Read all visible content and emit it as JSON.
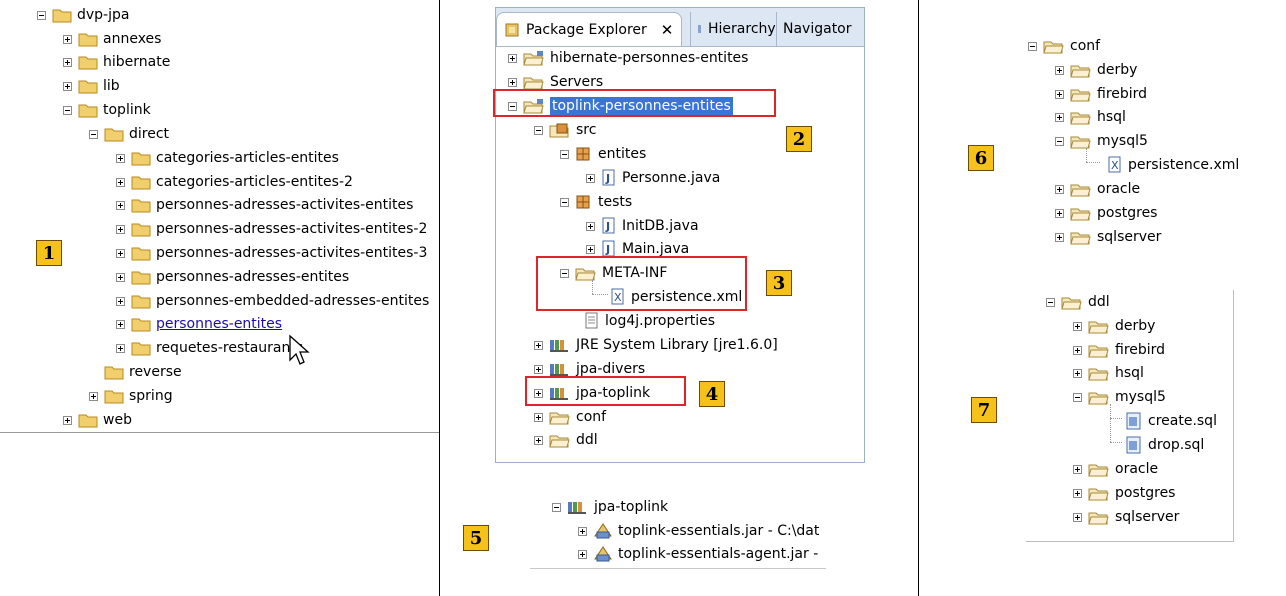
{
  "panel1": {
    "badge": "1",
    "tree": [
      {
        "label": "dvp-jpa",
        "exp": "minus"
      },
      {
        "label": "annexes",
        "exp": "plus"
      },
      {
        "label": "hibernate",
        "exp": "plus"
      },
      {
        "label": "lib",
        "exp": "plus"
      },
      {
        "label": "toplink",
        "exp": "minus"
      },
      {
        "label": "direct",
        "exp": "minus"
      },
      {
        "label": "categories-articles-entites",
        "exp": "plus"
      },
      {
        "label": "categories-articles-entites-2",
        "exp": "plus"
      },
      {
        "label": "personnes-adresses-activites-entites",
        "exp": "plus"
      },
      {
        "label": "personnes-adresses-activites-entites-2",
        "exp": "plus"
      },
      {
        "label": "personnes-adresses-activites-entites-3",
        "exp": "plus"
      },
      {
        "label": "personnes-adresses-entites",
        "exp": "plus"
      },
      {
        "label": "personnes-embedded-adresses-entites",
        "exp": "plus"
      },
      {
        "label": "personnes-entites",
        "exp": "plus"
      },
      {
        "label": "requetes-restaurants",
        "exp": "plus"
      },
      {
        "label": "reverse",
        "exp": "none"
      },
      {
        "label": "spring",
        "exp": "plus"
      },
      {
        "label": "web",
        "exp": "plus"
      }
    ]
  },
  "eclipse": {
    "tabs": {
      "active": "Package Explorer",
      "close": "✕",
      "hierarchy": "Hierarchy",
      "navigator": "Navigator"
    },
    "tree": [
      {
        "label": "hibernate-personnes-entites",
        "exp": "plus"
      },
      {
        "label": "Servers",
        "exp": "plus"
      },
      {
        "label": "toplink-personnes-entites",
        "exp": "minus"
      },
      {
        "label": "src",
        "exp": "minus"
      },
      {
        "label": "entites",
        "exp": "minus"
      },
      {
        "label": "Personne.java",
        "exp": "plus"
      },
      {
        "label": "tests",
        "exp": "minus"
      },
      {
        "label": "InitDB.java",
        "exp": "plus"
      },
      {
        "label": "Main.java",
        "exp": "plus"
      },
      {
        "label": "META-INF",
        "exp": "minus"
      },
      {
        "label": "persistence.xml",
        "exp": "none"
      },
      {
        "label": "log4j.properties",
        "exp": "none"
      },
      {
        "label": "JRE System Library [jre1.6.0]",
        "exp": "plus"
      },
      {
        "label": "jpa-divers",
        "exp": "plus"
      },
      {
        "label": "jpa-toplink",
        "exp": "plus"
      },
      {
        "label": "conf",
        "exp": "plus"
      },
      {
        "label": "ddl",
        "exp": "plus"
      }
    ],
    "badges": [
      "2",
      "3",
      "4"
    ]
  },
  "panel5": {
    "badge": "5",
    "tree": [
      {
        "label": "jpa-toplink",
        "exp": "minus"
      },
      {
        "label": "toplink-essentials.jar - C:\\dat",
        "exp": "plus"
      },
      {
        "label": "toplink-essentials-agent.jar -",
        "exp": "plus"
      }
    ]
  },
  "panel6": {
    "badge": "6",
    "tree": [
      {
        "label": "conf",
        "exp": "minus"
      },
      {
        "label": "derby",
        "exp": "plus"
      },
      {
        "label": "firebird",
        "exp": "plus"
      },
      {
        "label": "hsql",
        "exp": "plus"
      },
      {
        "label": "mysql5",
        "exp": "minus"
      },
      {
        "label": "persistence.xml",
        "exp": "none"
      },
      {
        "label": "oracle",
        "exp": "plus"
      },
      {
        "label": "postgres",
        "exp": "plus"
      },
      {
        "label": "sqlserver",
        "exp": "plus"
      }
    ]
  },
  "panel7": {
    "badge": "7",
    "tree": [
      {
        "label": "ddl",
        "exp": "minus"
      },
      {
        "label": "derby",
        "exp": "plus"
      },
      {
        "label": "firebird",
        "exp": "plus"
      },
      {
        "label": "hsql",
        "exp": "plus"
      },
      {
        "label": "mysql5",
        "exp": "minus"
      },
      {
        "label": "create.sql",
        "exp": "none"
      },
      {
        "label": "drop.sql",
        "exp": "none"
      },
      {
        "label": "oracle",
        "exp": "plus"
      },
      {
        "label": "postgres",
        "exp": "plus"
      },
      {
        "label": "sqlserver",
        "exp": "plus"
      }
    ]
  },
  "colors": {
    "badge": "#f6c21a",
    "highlight_box": "#e0242b",
    "selection": "#3875d7",
    "folder": "#f1cf6d"
  }
}
